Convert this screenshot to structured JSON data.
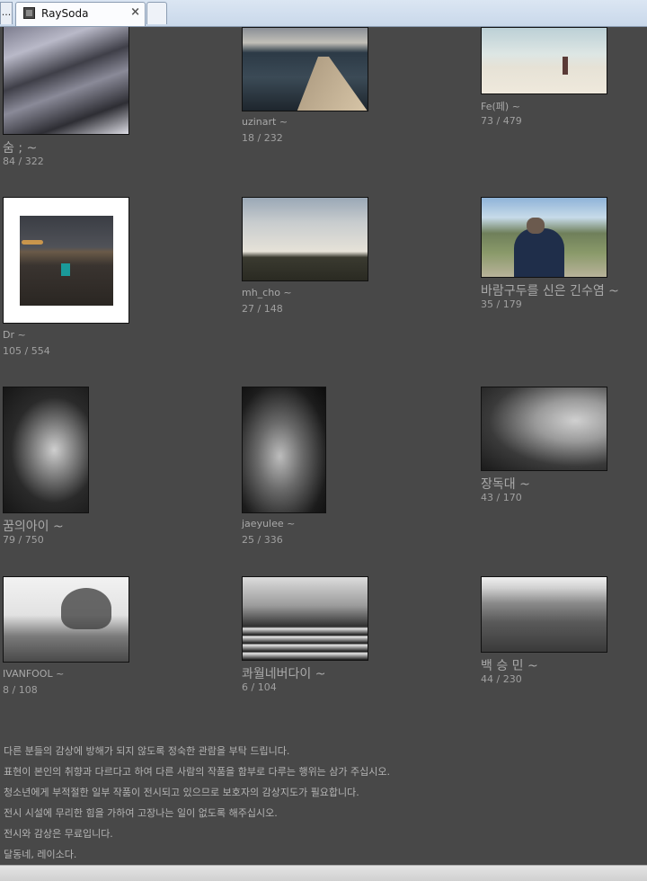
{
  "browser": {
    "overflow_label": "...",
    "tab_title": "RaySoda",
    "close_glyph": "×"
  },
  "gallery": [
    {
      "author": "숨 ; ~",
      "counts": "84 / 322",
      "author_size": "big"
    },
    {
      "author": "uzinart ~",
      "counts": "18 / 232",
      "author_size": "small"
    },
    {
      "author": "Fe(페) ~",
      "counts": "73 / 479",
      "author_size": "small"
    },
    {
      "author": "Dr ~",
      "counts": "105 / 554",
      "author_size": "small"
    },
    {
      "author": "mh_cho ~",
      "counts": "27 / 148",
      "author_size": "small"
    },
    {
      "author": "바람구두를 신은 긴수염 ~",
      "counts": "35 / 179",
      "author_size": "big"
    },
    {
      "author": "꿈의아이 ~",
      "counts": "79 / 750",
      "author_size": "big"
    },
    {
      "author": "jaeyulee ~",
      "counts": "25 / 336",
      "author_size": "small"
    },
    {
      "author": "장독대 ~",
      "counts": "43 / 170",
      "author_size": "big"
    },
    {
      "author": "IVANFOOL ~",
      "counts": "8 / 108",
      "author_size": "small"
    },
    {
      "author": "콰월네버다이 ~",
      "counts": "6 / 104",
      "author_size": "big"
    },
    {
      "author": "백 승 민 ~",
      "counts": "44 / 230",
      "author_size": "big"
    }
  ],
  "notice": [
    "다른 분들의 감상에 방해가 되지 않도록 정숙한 관람을 부탁 드립니다.",
    "표현이 본인의 취향과 다르다고 하여 다른 사람의 작품을 함부로 다루는 행위는 삼가 주십시오.",
    "청소년에게 부적절한 일부 작품이 전시되고 있으므로 보호자의 감상지도가 필요합니다.",
    "전시 시설에 무리한 힘을 가하여 고장나는 일이 없도록 해주십시오.",
    "전시와 감상은 무료입니다.",
    "달동네, 레이소다."
  ]
}
